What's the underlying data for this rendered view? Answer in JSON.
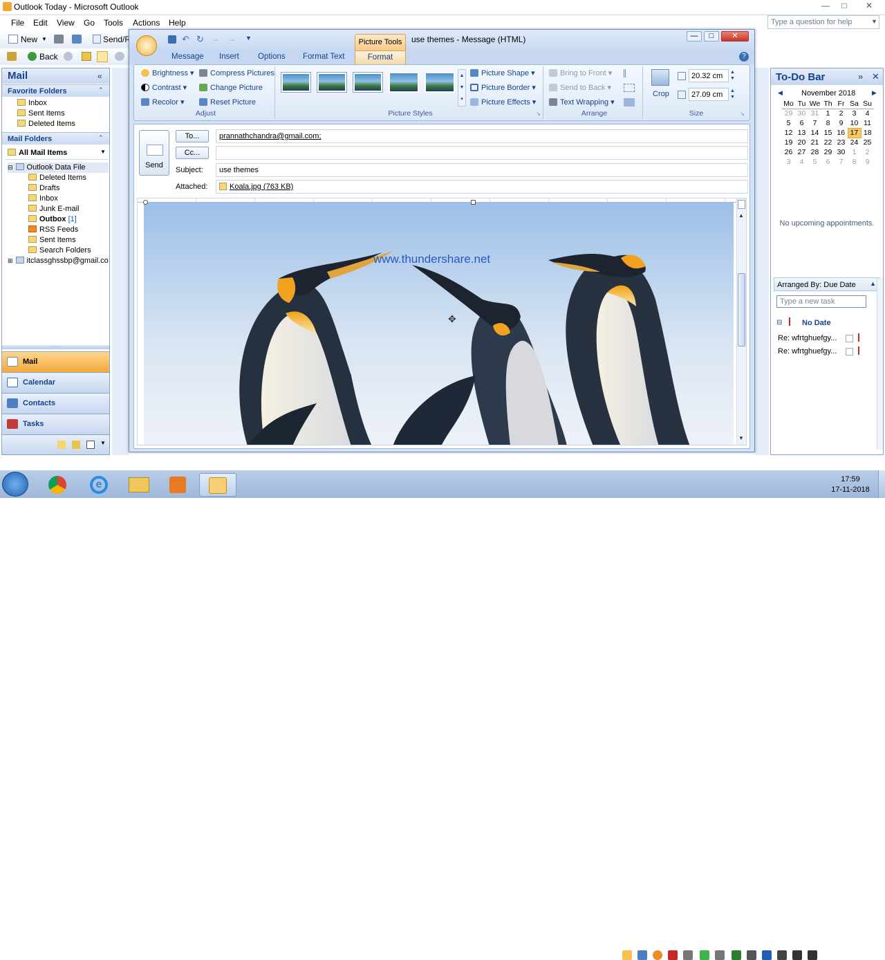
{
  "app": {
    "title": "Outlook Today - Microsoft Outlook"
  },
  "menu": [
    "File",
    "Edit",
    "View",
    "Go",
    "Tools",
    "Actions",
    "Help"
  ],
  "toolbar": {
    "new_label": "New",
    "send_receive_label": "Send/R",
    "back_label": "Back"
  },
  "help_box": {
    "placeholder": "Type a question for help"
  },
  "nav": {
    "header": "Mail",
    "favorite_folders_label": "Favorite Folders",
    "favorites": [
      "Inbox",
      "Sent Items",
      "Deleted Items"
    ],
    "mail_folders_label": "Mail Folders",
    "all_mail_items": "All Mail Items",
    "data_file": "Outlook Data File",
    "folders": [
      {
        "name": "Deleted Items",
        "count": ""
      },
      {
        "name": "Drafts",
        "count": ""
      },
      {
        "name": "Inbox",
        "count": ""
      },
      {
        "name": "Junk E-mail",
        "count": ""
      },
      {
        "name": "Outbox",
        "count": "[1]"
      },
      {
        "name": "RSS Feeds",
        "count": ""
      },
      {
        "name": "Sent Items",
        "count": ""
      },
      {
        "name": "Search Folders",
        "count": ""
      }
    ],
    "account": "itclassghssbp@gmail.co",
    "buttons": [
      "Mail",
      "Calendar",
      "Contacts",
      "Tasks"
    ]
  },
  "message": {
    "context_tab": "Picture Tools",
    "title": "use themes - Message (HTML)",
    "tabs": [
      "Message",
      "Insert",
      "Options",
      "Format Text",
      "Format"
    ],
    "active_tab": "Format",
    "adjust": {
      "brightness": "Brightness",
      "contrast": "Contrast",
      "recolor": "Recolor",
      "compress": "Compress Pictures",
      "change": "Change Picture",
      "reset": "Reset Picture",
      "label": "Adjust"
    },
    "styles": {
      "shape": "Picture Shape",
      "border": "Picture Border",
      "effects": "Picture Effects",
      "label": "Picture Styles"
    },
    "arrange": {
      "front": "Bring to Front",
      "back": "Send to Back",
      "wrap": "Text Wrapping",
      "label": "Arrange"
    },
    "size": {
      "crop": "Crop",
      "height": "20.32 cm",
      "width": "27.09 cm",
      "label": "Size"
    },
    "send": "Send",
    "to_label": "To...",
    "cc_label": "Cc...",
    "to": "prannathchandra@gmail.com;",
    "cc": "",
    "subject_label": "Subject:",
    "subject": "use themes",
    "attached_label": "Attached:",
    "attachment": "Koala.jpg (763 KB)",
    "watermark": "www.thundershare.net"
  },
  "todo": {
    "header": "To-Do Bar",
    "month": "November 2018",
    "weekdays": [
      "Mo",
      "Tu",
      "We",
      "Th",
      "Fr",
      "Sa",
      "Su"
    ],
    "weeks": [
      [
        "29",
        "30",
        "31",
        "1",
        "2",
        "3",
        "4"
      ],
      [
        "5",
        "6",
        "7",
        "8",
        "9",
        "10",
        "11"
      ],
      [
        "12",
        "13",
        "14",
        "15",
        "16",
        "17",
        "18"
      ],
      [
        "19",
        "20",
        "21",
        "22",
        "23",
        "24",
        "25"
      ],
      [
        "26",
        "27",
        "28",
        "29",
        "30",
        "1",
        "2"
      ],
      [
        "3",
        "4",
        "5",
        "6",
        "7",
        "8",
        "9"
      ]
    ],
    "today": "17",
    "no_appointments": "No upcoming appointments.",
    "arranged_by": "Arranged By: Due Date",
    "new_task_placeholder": "Type a new task",
    "group": "No Date",
    "tasks": [
      "Re: wfrtghuefgy...",
      "Re: wfrtghuefgy..."
    ]
  },
  "clock": {
    "time": "17:59",
    "date": "17-11-2018"
  }
}
